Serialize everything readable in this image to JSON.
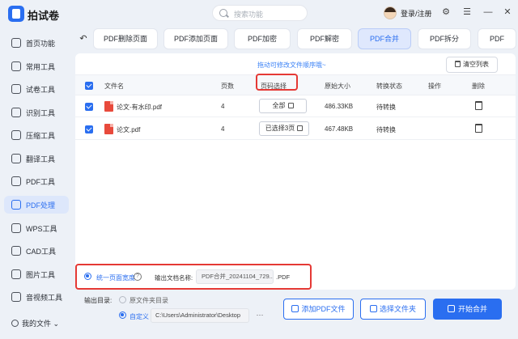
{
  "app": {
    "title": "拍试卷"
  },
  "header": {
    "search_placeholder": "搜索功能",
    "login_label": "登录/注册",
    "icons": [
      "search-icon",
      "avatar",
      "settings-icon",
      "menu-icon",
      "minimize-icon",
      "close-icon"
    ],
    "settings_glyph": "⚙",
    "menu_glyph": "☰",
    "minimize_glyph": "—",
    "close_glyph": "✕"
  },
  "sidebar": {
    "items": [
      {
        "label": "首页功能",
        "icon": "home-icon"
      },
      {
        "label": "常用工具",
        "icon": "layers-icon"
      },
      {
        "label": "试卷工具",
        "icon": "paper-icon"
      },
      {
        "label": "识别工具",
        "icon": "scan-icon"
      },
      {
        "label": "压缩工具",
        "icon": "compress-icon"
      },
      {
        "label": "翻译工具",
        "icon": "translate-icon"
      },
      {
        "label": "PDF工具",
        "icon": "pdf-icon"
      },
      {
        "label": "PDF处理",
        "icon": "pdf-process-icon",
        "active": true
      },
      {
        "label": "WPS工具",
        "icon": "wps-icon"
      },
      {
        "label": "CAD工具",
        "icon": "cad-icon"
      },
      {
        "label": "图片工具",
        "icon": "image-icon"
      },
      {
        "label": "音视频工具",
        "icon": "media-icon"
      }
    ],
    "my_files": "我的文件 ⌄"
  },
  "tabs": {
    "back_glyph": "↶",
    "items": [
      {
        "label": "PDF删除页面"
      },
      {
        "label": "PDF添加页面"
      },
      {
        "label": "PDF加密"
      },
      {
        "label": "PDF解密"
      },
      {
        "label": "PDF合并",
        "active": true
      },
      {
        "label": "PDF拆分"
      },
      {
        "label": "PDF"
      }
    ]
  },
  "panel": {
    "hint": "拖动可修改文件顺序哦~",
    "clear_label": "清空列表",
    "columns": [
      "文件名",
      "页数",
      "页码选择",
      "原始大小",
      "转换状态",
      "操作",
      "删除"
    ],
    "rows": [
      {
        "name": "论文-有水印.pdf",
        "pages": "4",
        "page_select": "全部",
        "size": "486.33KB",
        "status": "待转换"
      },
      {
        "name": "论文.pdf",
        "pages": "4",
        "page_select": "已选择3页",
        "size": "467.48KB",
        "status": "待转换"
      }
    ]
  },
  "options": {
    "uniform_width": "统一页面宽度",
    "help_glyph": "?",
    "output_name_label": "输出文档名称:",
    "output_name_value": "PDF合并_20241104_729...",
    "output_ext": ".PDF"
  },
  "bottom": {
    "output_dir_label": "输出目录:",
    "source_dir_label": "原文件夹目录",
    "custom_label": "自定义",
    "path_value": "C:\\Users\\Administrator\\Desktop",
    "dots": "···",
    "add_pdf": "添加PDF文件",
    "select_folder": "选择文件夹",
    "start": "开始合并"
  },
  "colors": {
    "accent": "#2a6ef0",
    "highlight": "#e53935",
    "pdf_red": "#e84a3c"
  }
}
